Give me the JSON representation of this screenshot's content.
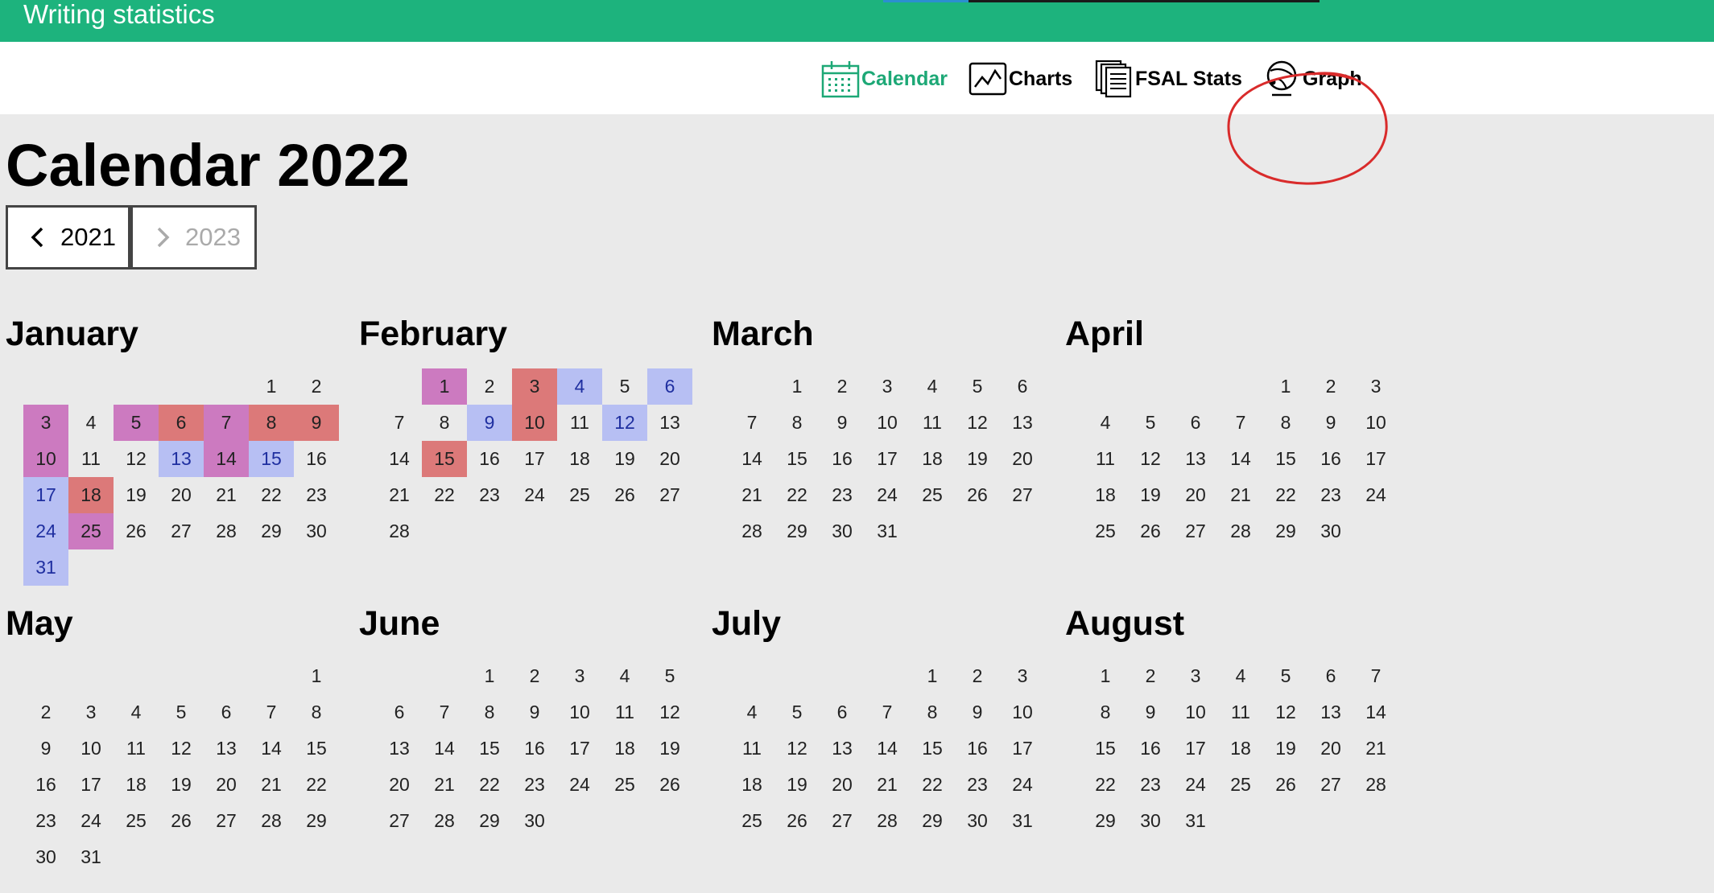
{
  "app": {
    "title": "Writing statistics"
  },
  "nav": {
    "items": [
      {
        "label": "Calendar",
        "icon": "calendar-icon",
        "active": true
      },
      {
        "label": "Charts",
        "icon": "chart-line-icon",
        "active": false
      },
      {
        "label": "FSAL Stats",
        "icon": "documents-stack-icon",
        "active": false
      },
      {
        "label": "Graph",
        "icon": "graph-globe-icon",
        "active": false
      }
    ]
  },
  "page": {
    "title": "Calendar 2022"
  },
  "year_nav": {
    "prev_label": "2021",
    "next_label": "2023",
    "next_disabled": true
  },
  "colors": {
    "header": "#1db37d",
    "active_nav": "#1da876",
    "heat_magenta": "#cc7ac0",
    "heat_red": "#dc7979",
    "heat_blue": "#b7bff3",
    "annotation": "#d92b2b"
  },
  "months": [
    {
      "name": "January",
      "offset": 5,
      "days": 31,
      "highlights": {
        "3": "mag",
        "5": "mag",
        "6": "red",
        "7": "mag",
        "8": "red",
        "9": "red",
        "10": "mag",
        "13": "blue",
        "14": "mag",
        "15": "blue",
        "17": "blue",
        "18": "red",
        "24": "blue",
        "25": "mag",
        "31": "blue"
      }
    },
    {
      "name": "February",
      "offset": 1,
      "days": 28,
      "highlights": {
        "1": "mag",
        "3": "red",
        "4": "blue",
        "6": "blue",
        "9": "blue",
        "10": "red",
        "12": "blue",
        "15": "red"
      }
    },
    {
      "name": "March",
      "offset": 1,
      "days": 31,
      "highlights": {}
    },
    {
      "name": "April",
      "offset": 4,
      "days": 30,
      "highlights": {}
    },
    {
      "name": "May",
      "offset": 6,
      "days": 31,
      "highlights": {}
    },
    {
      "name": "June",
      "offset": 2,
      "days": 30,
      "highlights": {}
    },
    {
      "name": "July",
      "offset": 4,
      "days": 31,
      "highlights": {}
    },
    {
      "name": "August",
      "offset": 0,
      "days": 31,
      "highlights": {}
    }
  ]
}
